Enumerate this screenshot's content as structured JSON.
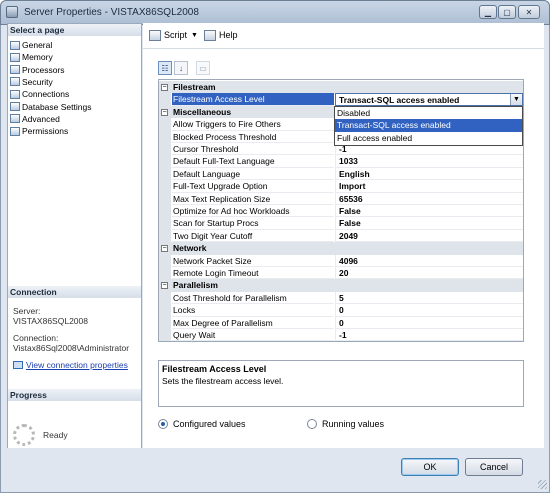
{
  "window": {
    "title": "Server Properties - VISTAX86SQL2008"
  },
  "left_panel": {
    "select_page_header": "Select a page",
    "pages": [
      "General",
      "Memory",
      "Processors",
      "Security",
      "Connections",
      "Database Settings",
      "Advanced",
      "Permissions"
    ],
    "connection_header": "Connection",
    "server_label": "Server:",
    "server_value": "VISTAX86SQL2008",
    "connection_label": "Connection:",
    "connection_value": "Vistax86Sql2008\\Administrator",
    "view_connection_link": "View connection properties",
    "progress_header": "Progress",
    "progress_status": "Ready"
  },
  "toolbar": {
    "script_label": "Script",
    "help_label": "Help"
  },
  "grid": {
    "categories": [
      {
        "title": "Filestream",
        "rows": [
          {
            "name": "Filestream Access Level",
            "value": "Transact-SQL access enabled"
          }
        ]
      },
      {
        "title": "Miscellaneous",
        "rows": [
          {
            "name": "Allow Triggers to Fire Others",
            "value": "True"
          },
          {
            "name": "Blocked Process Threshold",
            "value": "0"
          },
          {
            "name": "Cursor Threshold",
            "value": "-1"
          },
          {
            "name": "Default Full-Text Language",
            "value": "1033"
          },
          {
            "name": "Default Language",
            "value": "English"
          },
          {
            "name": "Full-Text Upgrade Option",
            "value": "Import"
          },
          {
            "name": "Max Text Replication Size",
            "value": "65536"
          },
          {
            "name": "Optimize for Ad hoc Workloads",
            "value": "False"
          },
          {
            "name": "Scan for Startup Procs",
            "value": "False"
          },
          {
            "name": "Two Digit Year Cutoff",
            "value": "2049"
          }
        ]
      },
      {
        "title": "Network",
        "rows": [
          {
            "name": "Network Packet Size",
            "value": "4096"
          },
          {
            "name": "Remote Login Timeout",
            "value": "20"
          }
        ]
      },
      {
        "title": "Parallelism",
        "rows": [
          {
            "name": "Cost Threshold for Parallelism",
            "value": "5"
          },
          {
            "name": "Locks",
            "value": "0"
          },
          {
            "name": "Max Degree of Parallelism",
            "value": "0"
          },
          {
            "name": "Query Wait",
            "value": "-1"
          }
        ]
      }
    ],
    "dropdown_options": [
      "Disabled",
      "Transact-SQL access enabled",
      "Full access enabled"
    ],
    "dropdown_highlighted_index": 1
  },
  "description": {
    "title": "Filestream Access Level",
    "text": "Sets the filestream access level."
  },
  "radios": {
    "configured": "Configured values",
    "running": "Running values",
    "selected": "configured"
  },
  "buttons": {
    "ok": "OK",
    "cancel": "Cancel"
  }
}
